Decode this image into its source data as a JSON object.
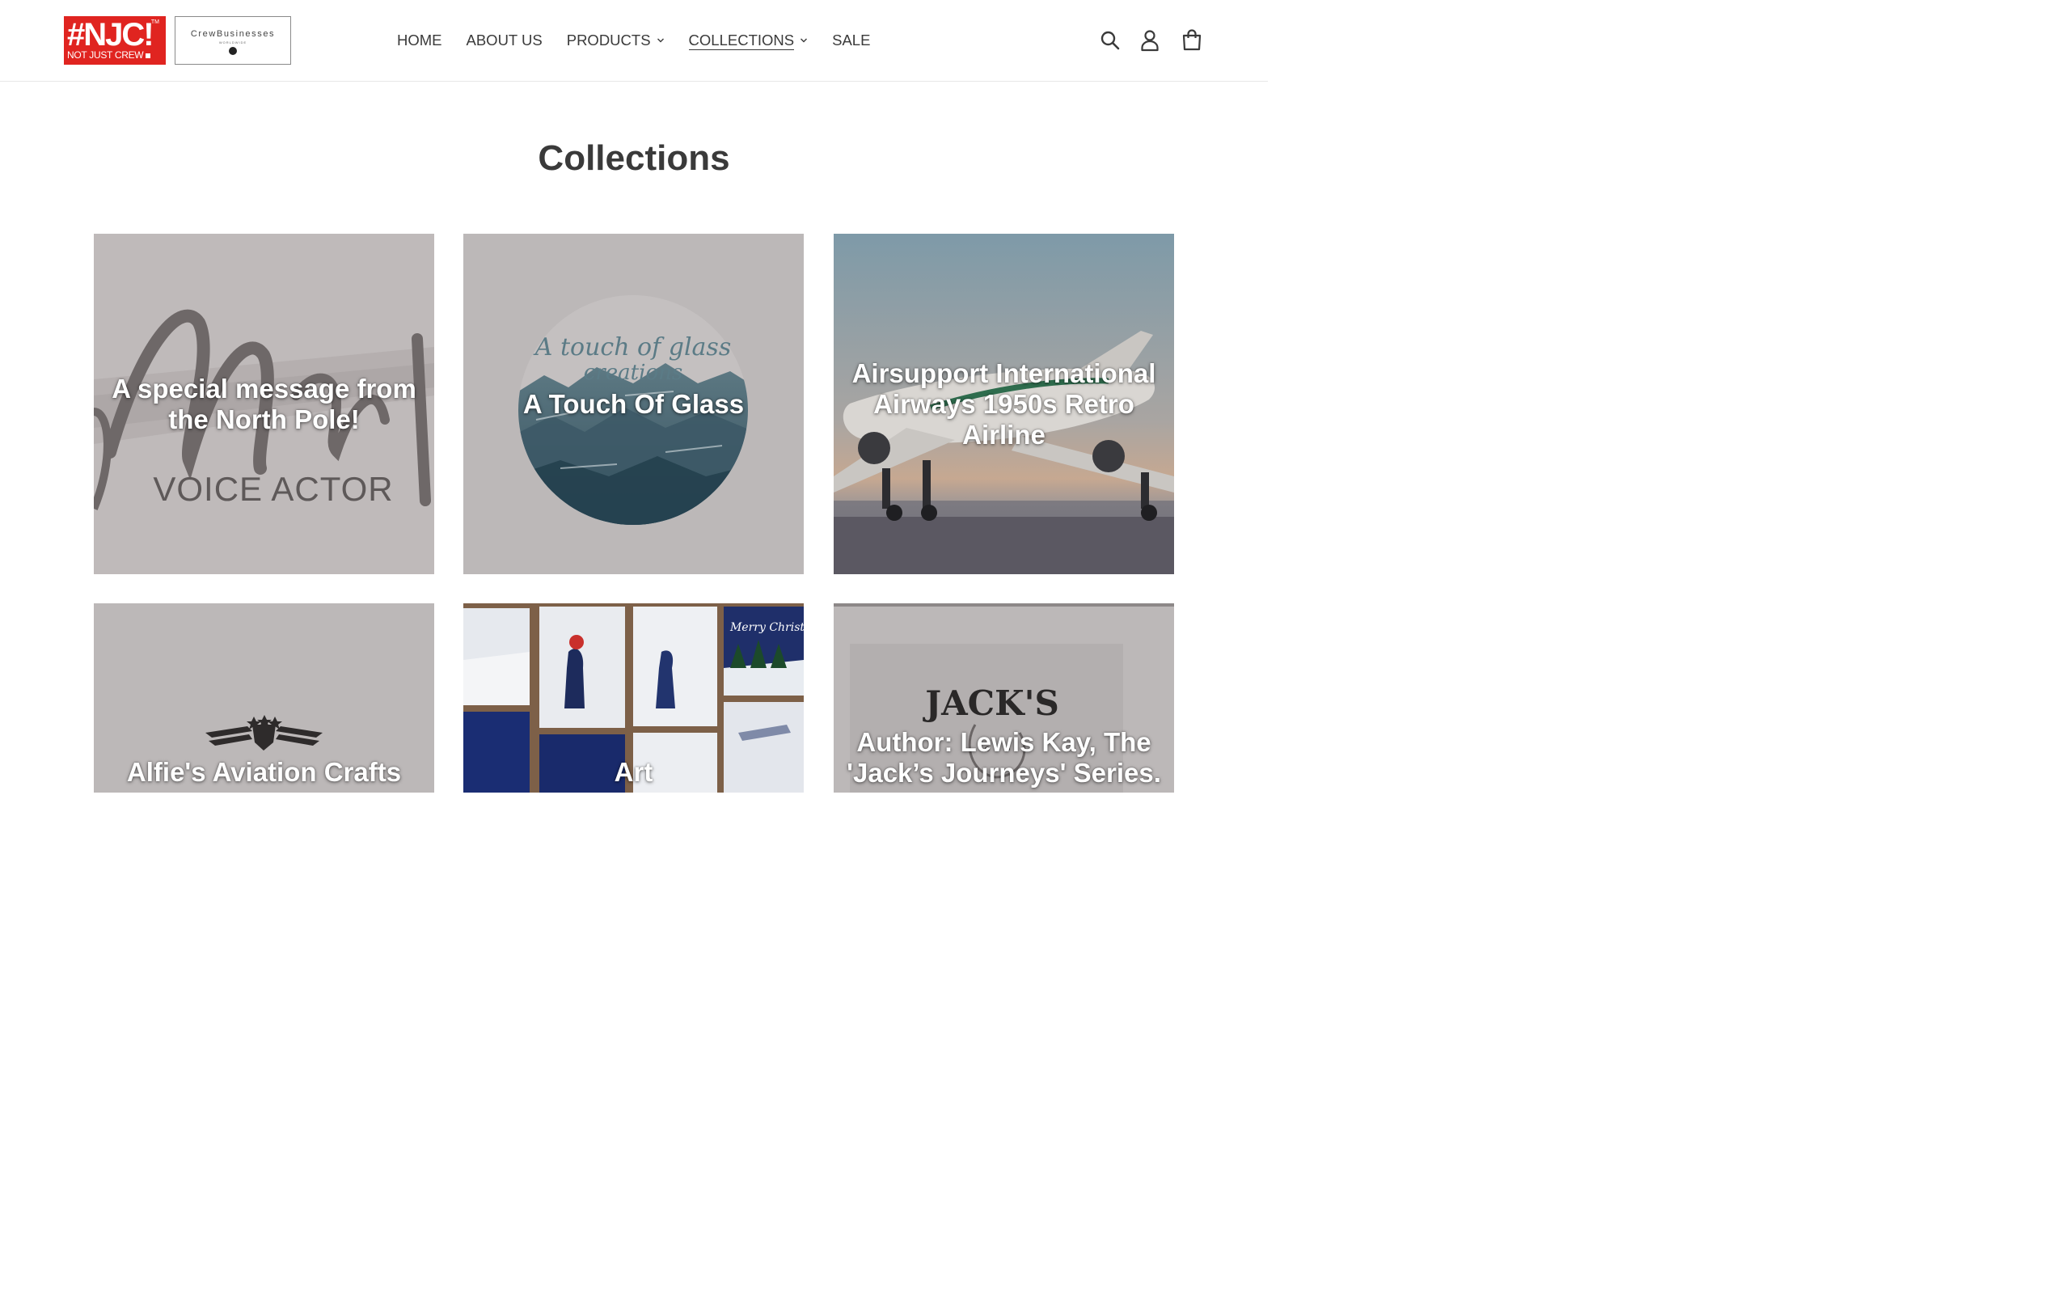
{
  "header": {
    "logo_njc": {
      "main": "#NJC!",
      "tagline": "NOT JUST CREW",
      "tm": "TM"
    },
    "logo_crew": {
      "name": "CrewBusinesses",
      "sub": "WORLDWIDE"
    },
    "nav": [
      {
        "label": "HOME",
        "has_dropdown": false,
        "active": false
      },
      {
        "label": "ABOUT US",
        "has_dropdown": false,
        "active": false
      },
      {
        "label": "PRODUCTS",
        "has_dropdown": true,
        "active": false
      },
      {
        "label": "COLLECTIONS",
        "has_dropdown": true,
        "active": true
      },
      {
        "label": "SALE",
        "has_dropdown": false,
        "active": false
      }
    ],
    "icons": [
      "search-icon",
      "account-icon",
      "cart-icon"
    ]
  },
  "main": {
    "title": "Collections",
    "collections": [
      {
        "title": "A special message from the North Pole!",
        "image_text": "VOICE ACTOR"
      },
      {
        "title": "A Touch Of Glass",
        "image_text": "A touch of glass creations"
      },
      {
        "title": "Airsupport International Airways 1950s Retro Airline",
        "image_text": ""
      },
      {
        "title": "Alfie's Aviation Crafts",
        "image_text": ""
      },
      {
        "title": "Art",
        "image_text": ""
      },
      {
        "title": "Author: Lewis Kay, The 'Jack’s Journeys' Series.",
        "image_text": "JACK'S"
      }
    ]
  },
  "colors": {
    "text": "#3a3a3a",
    "logo_red": "#e02420",
    "card_overlay": "#bcb8b8",
    "card_title": "#ffffff"
  }
}
